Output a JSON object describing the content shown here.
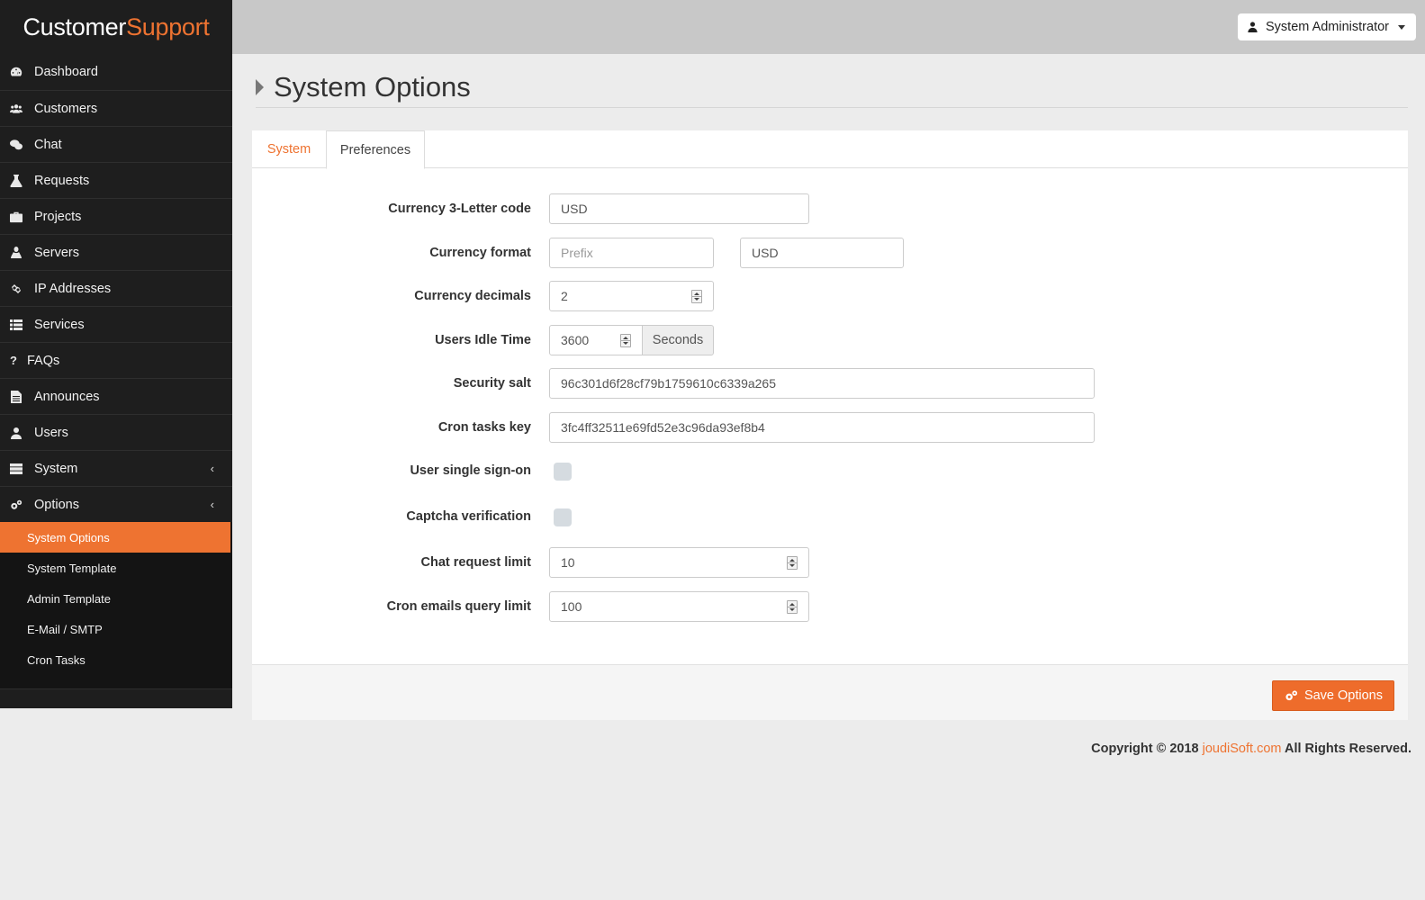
{
  "brand": {
    "part1": "Customer",
    "part2": "Support"
  },
  "sidebar": {
    "items": [
      {
        "label": "Dashboard",
        "icon": "dashboard-icon"
      },
      {
        "label": "Customers",
        "icon": "users-icon"
      },
      {
        "label": "Chat",
        "icon": "chat-icon"
      },
      {
        "label": "Requests",
        "icon": "flask-icon"
      },
      {
        "label": "Projects",
        "icon": "briefcase-icon"
      },
      {
        "label": "Servers",
        "icon": "linux-icon"
      },
      {
        "label": "IP Addresses",
        "icon": "link-icon"
      },
      {
        "label": "Services",
        "icon": "list-icon"
      },
      {
        "label": "FAQs",
        "icon": "question-icon"
      },
      {
        "label": "Announces",
        "icon": "file-icon"
      },
      {
        "label": "Users",
        "icon": "user-secret-icon"
      },
      {
        "label": "System",
        "icon": "server-icon"
      },
      {
        "label": "Options",
        "icon": "cogs-icon"
      }
    ],
    "options_sub": [
      {
        "label": "System Options",
        "active": true
      },
      {
        "label": "System Template"
      },
      {
        "label": "Admin Template"
      },
      {
        "label": "E-Mail / SMTP"
      },
      {
        "label": "Cron Tasks"
      }
    ]
  },
  "topbar": {
    "user_label": "System Administrator"
  },
  "page": {
    "title": "System Options"
  },
  "tabs": [
    {
      "label": "System"
    },
    {
      "label": "Preferences"
    }
  ],
  "form": {
    "currency_code": {
      "label": "Currency 3-Letter code",
      "value": "USD"
    },
    "currency_format": {
      "label": "Currency format",
      "prefix_placeholder": "Prefix",
      "suffix_value": "USD"
    },
    "currency_decimals": {
      "label": "Currency decimals",
      "value": "2"
    },
    "idle_time": {
      "label": "Users Idle Time",
      "value": "3600",
      "unit": "Seconds"
    },
    "security_salt": {
      "label": "Security salt",
      "value": "96c301d6f28cf79b1759610c6339a265"
    },
    "cron_key": {
      "label": "Cron tasks key",
      "value": "3fc4ff32511e69fd52e3c96da93ef8b4"
    },
    "sso": {
      "label": "User single sign-on",
      "checked": false
    },
    "captcha": {
      "label": "Captcha verification",
      "checked": false
    },
    "chat_limit": {
      "label": "Chat request limit",
      "value": "10"
    },
    "cron_emails_limit": {
      "label": "Cron emails query limit",
      "value": "100"
    }
  },
  "actions": {
    "save_label": "Save Options"
  },
  "footer": {
    "prefix": "Copyright © 2018 ",
    "link": "joudiSoft.com",
    "suffix": " All Rights Reserved."
  },
  "colors": {
    "accent": "#ee7331",
    "sidebar": "#1e1e1e",
    "topbar": "#c8c8c8"
  }
}
